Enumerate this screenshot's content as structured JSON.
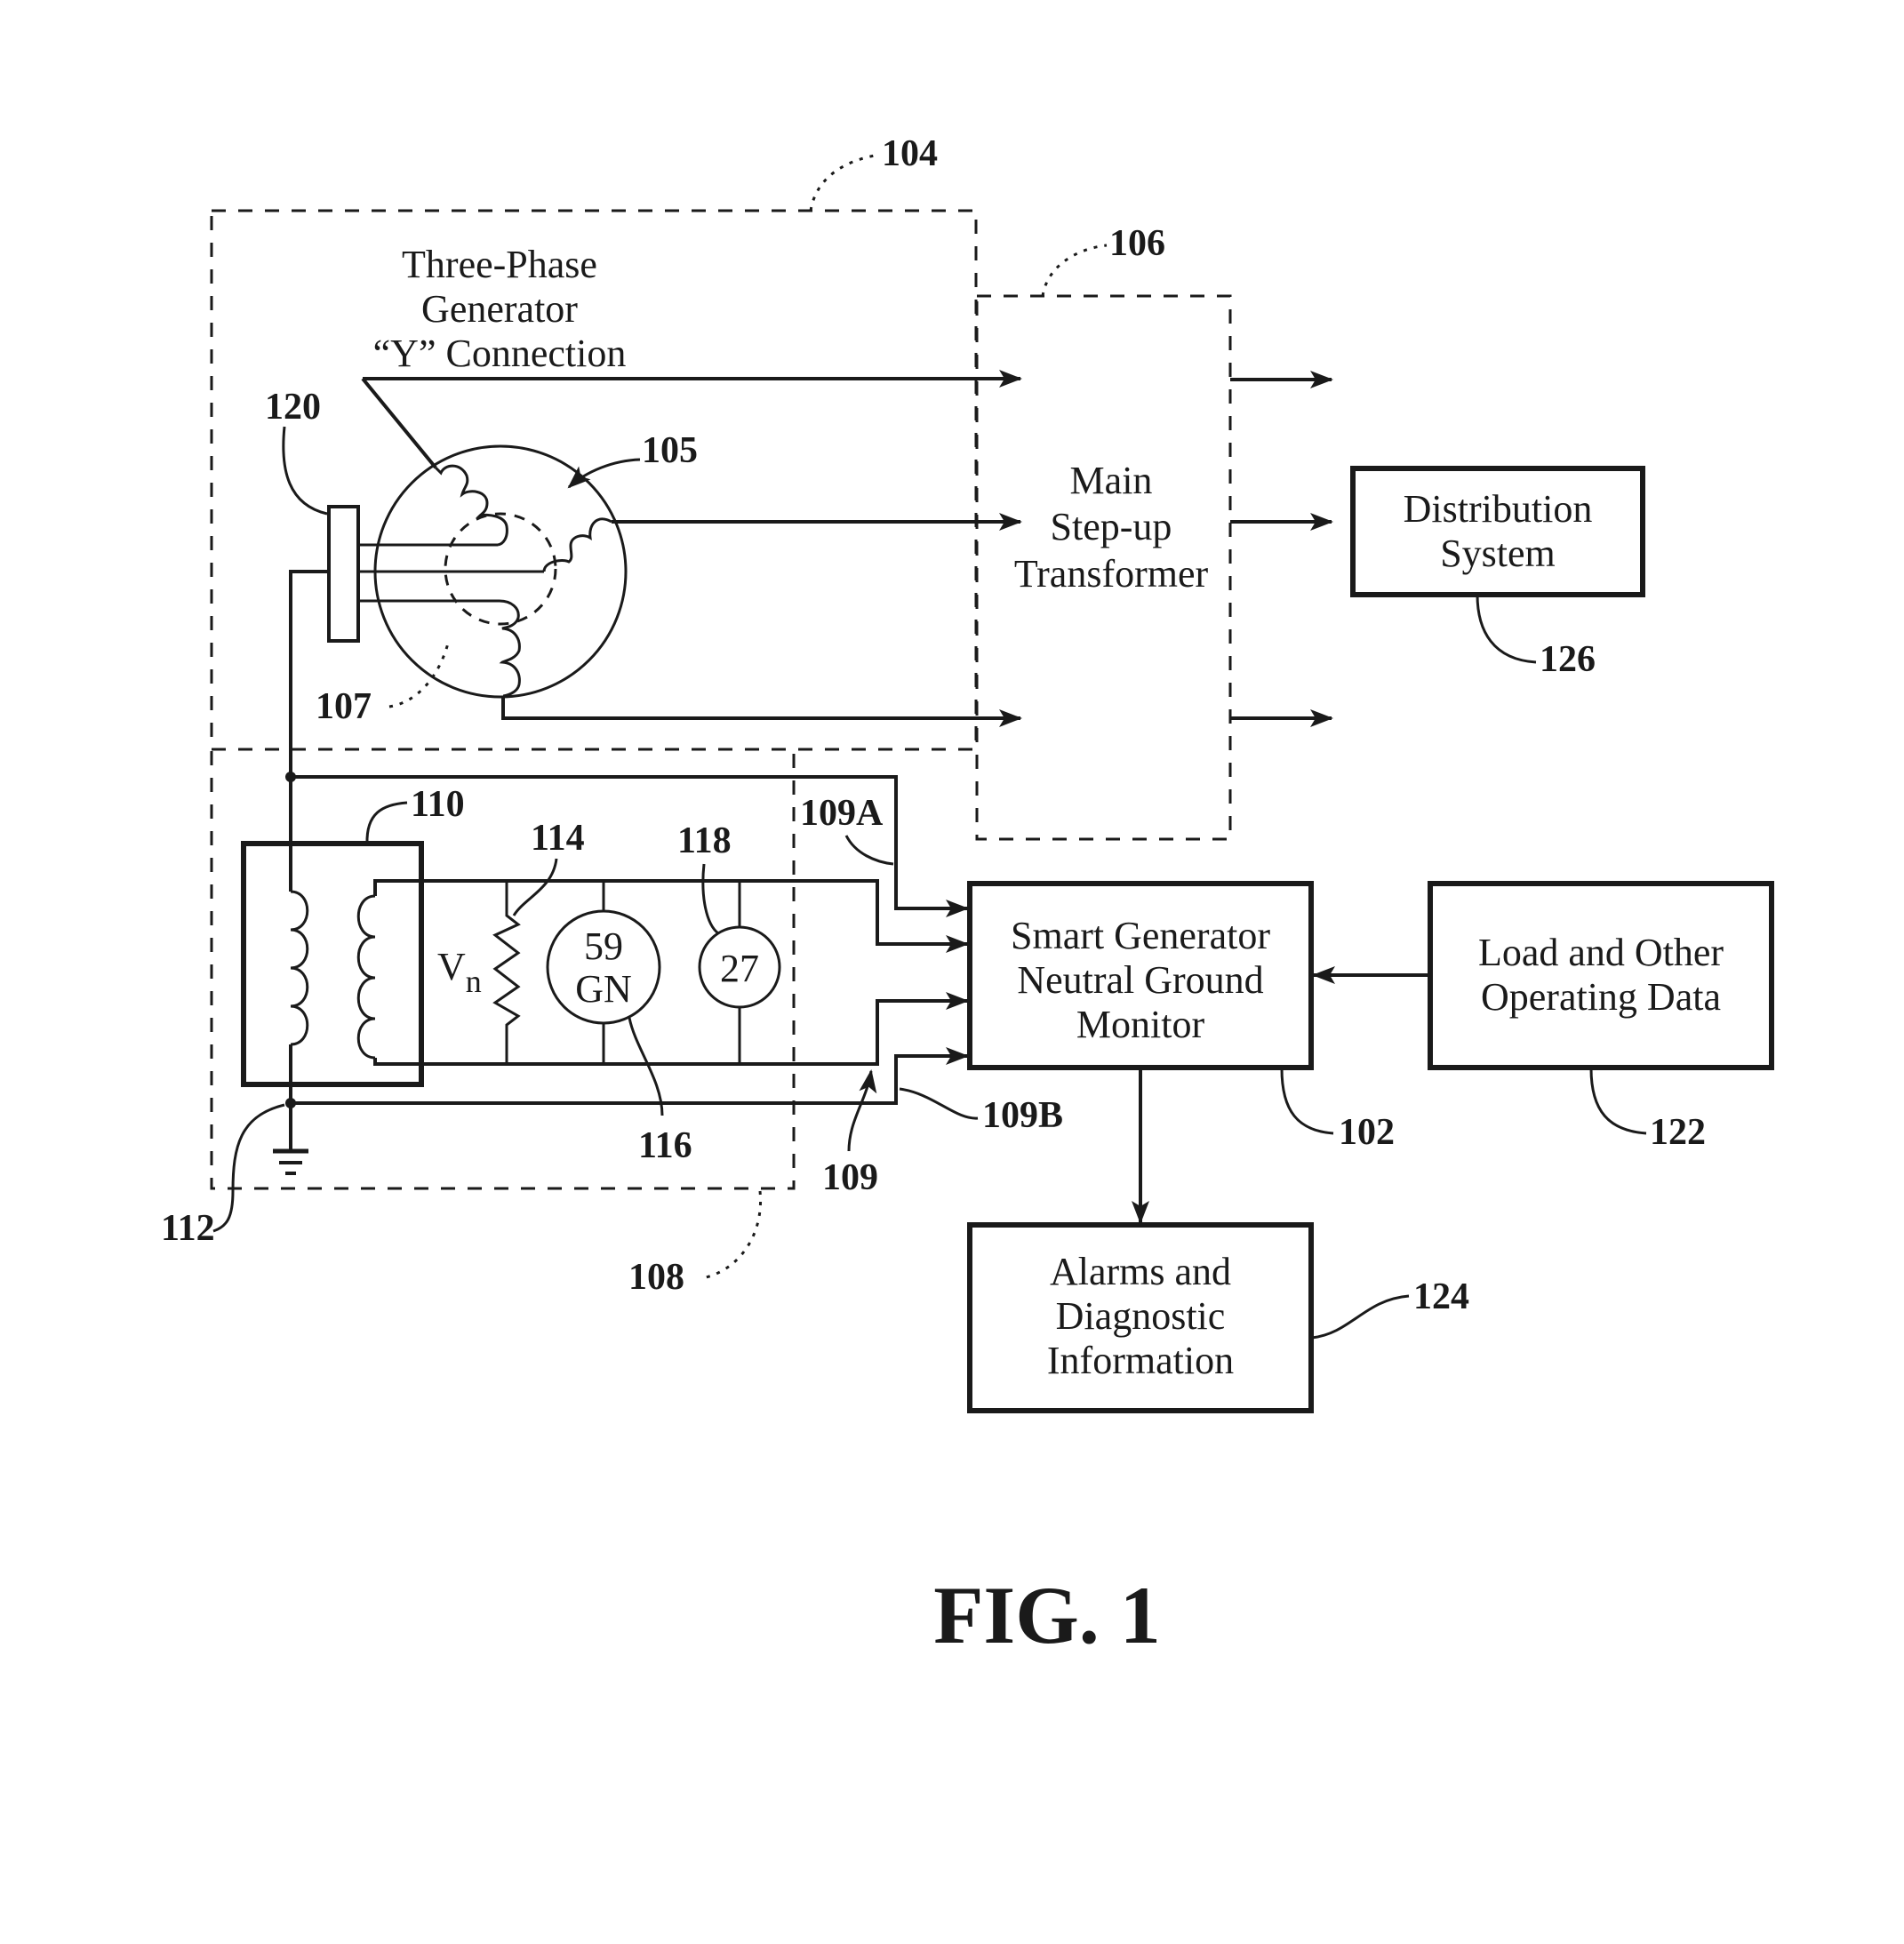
{
  "figure": {
    "caption": "FIG. 1",
    "colors": {
      "ink": "#1a1a1a",
      "paper": "#ffffff"
    }
  },
  "generator": {
    "title_lines": [
      "Three-Phase",
      "Generator",
      "“Y” Connection"
    ],
    "ref_enclosure": "104",
    "ref_windings": "105",
    "ref_neutral": "107",
    "ref_slip_ring": "120"
  },
  "transformer": {
    "lines": [
      "Main",
      "Step-up",
      "Transformer"
    ],
    "ref": "106"
  },
  "distribution": {
    "lines": [
      "Distribution",
      "System"
    ],
    "ref": "126"
  },
  "grounding": {
    "ref_enclosure": "108",
    "ref_transformer": "110",
    "ref_ground": "112",
    "ref_resistor": "114",
    "resistor_label": "V",
    "resistor_label_sub": "n",
    "relay_59gn_lines": [
      "59",
      "GN"
    ],
    "ref_59gn": "116",
    "relay_27": "27",
    "ref_27": "118"
  },
  "signals": {
    "ref_bundle": "109",
    "ref_a": "109A",
    "ref_b": "109B"
  },
  "monitor": {
    "lines": [
      "Smart Generator",
      "Neutral Ground",
      "Monitor"
    ],
    "ref": "102"
  },
  "load_data": {
    "lines": [
      "Load and Other",
      "Operating Data"
    ],
    "ref": "122"
  },
  "alarms": {
    "lines": [
      "Alarms and",
      "Diagnostic",
      "Information"
    ],
    "ref": "124"
  }
}
